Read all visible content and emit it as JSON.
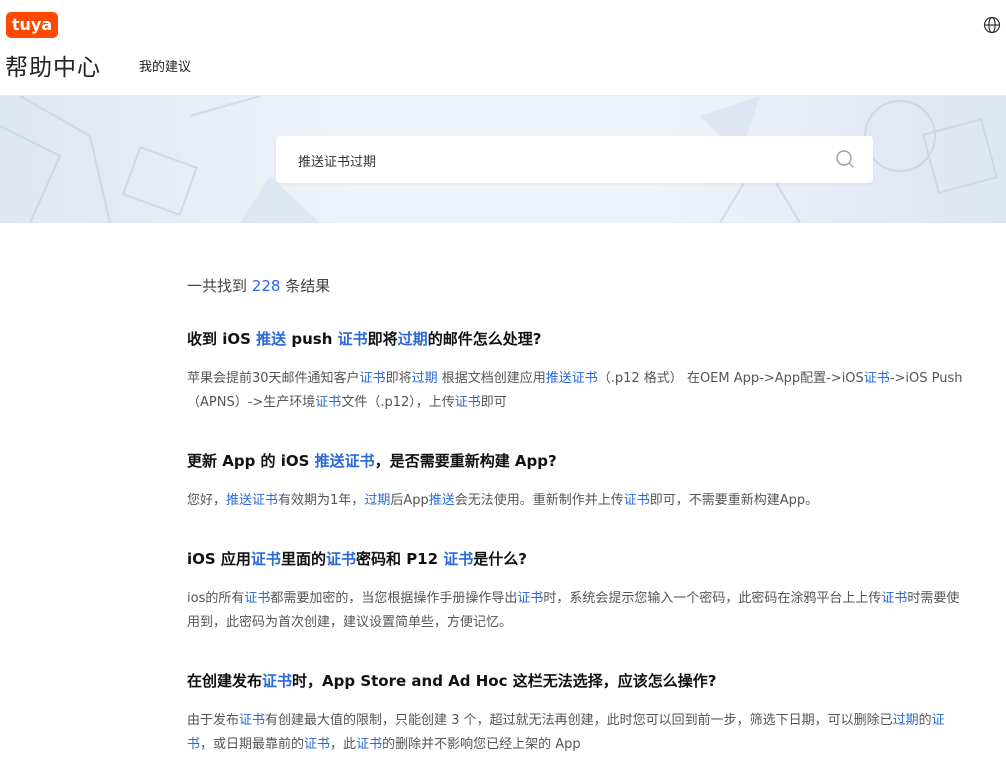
{
  "header": {
    "logo_text": "tuya",
    "site_title": "帮助中心",
    "nav": {
      "suggestions": "我的建议"
    },
    "globe_icon": "globe-icon"
  },
  "search": {
    "value": "推送证书过期",
    "icon": "search-icon"
  },
  "results": {
    "prefix": "一共找到",
    "count": "228",
    "suffix": "条结果"
  },
  "colors": {
    "brand": "#ff4800",
    "highlight": "#2a6ad8"
  },
  "items": [
    {
      "title": [
        {
          "t": "收到 iOS "
        },
        {
          "t": "推送",
          "hl": true
        },
        {
          "t": " push "
        },
        {
          "t": "证书",
          "hl": true
        },
        {
          "t": "即将"
        },
        {
          "t": "过期",
          "hl": true
        },
        {
          "t": "的邮件怎么处理?"
        }
      ],
      "desc": [
        {
          "t": "苹果会提前30天邮件通知客户"
        },
        {
          "t": "证书",
          "hl": true
        },
        {
          "t": "即将"
        },
        {
          "t": "过期",
          "hl": true
        },
        {
          "t": " 根据文档创建应用"
        },
        {
          "t": "推送证书",
          "hl": true
        },
        {
          "t": "（.p12 格式） 在OEM App->App配置->iOS"
        },
        {
          "t": "证书",
          "hl": true
        },
        {
          "t": "->iOS Push（APNS）->生产环境"
        },
        {
          "t": "证书",
          "hl": true
        },
        {
          "t": "文件（.p12），上传"
        },
        {
          "t": "证书",
          "hl": true
        },
        {
          "t": "即可"
        }
      ]
    },
    {
      "title": [
        {
          "t": "更新 App 的 iOS "
        },
        {
          "t": "推送证书",
          "hl": true
        },
        {
          "t": "，是否需要重新构建 App?"
        }
      ],
      "desc": [
        {
          "t": "您好，"
        },
        {
          "t": "推送证书",
          "hl": true
        },
        {
          "t": "有效期为1年，"
        },
        {
          "t": "过期",
          "hl": true
        },
        {
          "t": "后App"
        },
        {
          "t": "推送",
          "hl": true
        },
        {
          "t": "会无法使用。重新制作并上传"
        },
        {
          "t": "证书",
          "hl": true
        },
        {
          "t": "即可，不需要重新构建App。"
        }
      ]
    },
    {
      "title": [
        {
          "t": "iOS 应用"
        },
        {
          "t": "证书",
          "hl": true
        },
        {
          "t": "里面的"
        },
        {
          "t": "证书",
          "hl": true
        },
        {
          "t": "密码和 P12 "
        },
        {
          "t": "证书",
          "hl": true
        },
        {
          "t": "是什么?"
        }
      ],
      "desc": [
        {
          "t": "ios的所有"
        },
        {
          "t": "证书",
          "hl": true
        },
        {
          "t": "都需要加密的，当您根据操作手册操作导出"
        },
        {
          "t": "证书",
          "hl": true
        },
        {
          "t": "时，系统会提示您输入一个密码，此密码在涂鸦平台上上传"
        },
        {
          "t": "证书",
          "hl": true
        },
        {
          "t": "时需要使用到，此密码为首次创建，建议设置简单些，方便记忆。"
        }
      ]
    },
    {
      "title": [
        {
          "t": "在创建发布"
        },
        {
          "t": "证书",
          "hl": true
        },
        {
          "t": "时，App Store and Ad Hoc 这栏无法选择，应该怎么操作?"
        }
      ],
      "desc": [
        {
          "t": "由于发布"
        },
        {
          "t": "证书",
          "hl": true
        },
        {
          "t": "有创建最大值的限制，只能创建 3 个，超过就无法再创建，此时您可以回到前一步，筛选下日期，可以删除已"
        },
        {
          "t": "过期",
          "hl": true
        },
        {
          "t": "的"
        },
        {
          "t": "证书",
          "hl": true
        },
        {
          "t": "，或日期最靠前的"
        },
        {
          "t": "证书",
          "hl": true
        },
        {
          "t": "，此"
        },
        {
          "t": "证书",
          "hl": true
        },
        {
          "t": "的删除并不影响您已经上架的 App"
        }
      ]
    }
  ]
}
